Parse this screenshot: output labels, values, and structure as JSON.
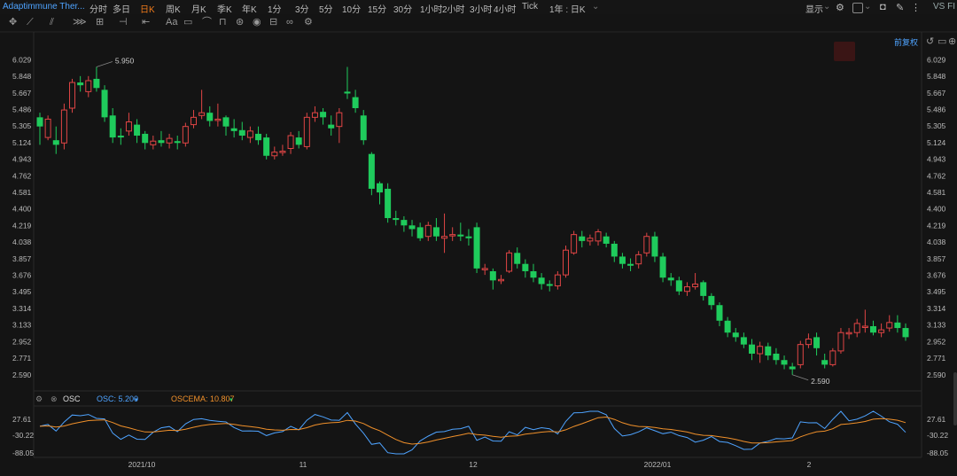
{
  "topbar": {
    "title": "Adaptimmune Ther...",
    "timeframes": [
      "分时",
      "多日",
      "日K",
      "周K",
      "月K",
      "季K",
      "年K",
      "1分",
      "3分",
      "5分",
      "10分",
      "15分",
      "30分",
      "1小时",
      "2小时",
      "3小时",
      "4小时",
      "Tick"
    ],
    "active_timeframe": "日K",
    "period_select": "1年 : 日K",
    "display_label": "显示",
    "compare_label": "VS FI"
  },
  "toolbar": {
    "icons": [
      "move-icon",
      "line-icon",
      "channel-icon",
      "fib-icon",
      "measure-icon",
      "hline-icon",
      "arrow-icon",
      "text-icon",
      "note-icon",
      "brush-icon",
      "magnet-icon",
      "eye-icon",
      "delete-icon",
      "link-icon",
      "settings-icon"
    ]
  },
  "chart_controls": {
    "adjust_label": "前复权"
  },
  "indicator": {
    "name": "OSC",
    "osc_label": "OSC: 5.200",
    "oscema_label": "OSCEMA: 10.807",
    "osc_color": "#4ea3ff",
    "oscema_color": "#f0902a",
    "y_ticks": [
      "27.61",
      "-30.22",
      "-88.05"
    ]
  },
  "chart_data": {
    "type": "candlestick",
    "up_color": "#e04545",
    "down_color": "#1fcb5c",
    "y_ticks": [
      "6.029",
      "5.848",
      "5.667",
      "5.486",
      "5.305",
      "5.124",
      "4.943",
      "4.762",
      "4.581",
      "4.400",
      "4.219",
      "4.038",
      "3.857",
      "3.676",
      "3.495",
      "3.314",
      "3.133",
      "2.952",
      "2.771",
      "2.590"
    ],
    "ylim": [
      2.52,
      6.1
    ],
    "x_ticks": [
      "2021/10",
      "11",
      "12",
      "2022/01",
      "2"
    ],
    "high_annotation": "5.950",
    "low_annotation": "2.590",
    "candles": [
      [
        5.4,
        5.3,
        5.45,
        5.1
      ],
      [
        5.18,
        5.38,
        5.42,
        5.15
      ],
      [
        5.15,
        5.1,
        5.3,
        5.0
      ],
      [
        5.12,
        5.48,
        5.55,
        5.05
      ],
      [
        5.5,
        5.78,
        5.82,
        5.45
      ],
      [
        5.78,
        5.75,
        5.85,
        5.68
      ],
      [
        5.68,
        5.8,
        5.85,
        5.62
      ],
      [
        5.82,
        5.72,
        5.95,
        5.68
      ],
      [
        5.7,
        5.4,
        5.75,
        5.35
      ],
      [
        5.42,
        5.18,
        5.5,
        5.12
      ],
      [
        5.2,
        5.18,
        5.28,
        5.1
      ],
      [
        5.25,
        5.35,
        5.45,
        5.2
      ],
      [
        5.32,
        5.2,
        5.38,
        5.12
      ],
      [
        5.22,
        5.12,
        5.25,
        5.05
      ],
      [
        5.1,
        5.14,
        5.2,
        5.05
      ],
      [
        5.15,
        5.12,
        5.25,
        5.08
      ],
      [
        5.12,
        5.17,
        5.22,
        5.06
      ],
      [
        5.14,
        5.12,
        5.2,
        5.05
      ],
      [
        5.12,
        5.3,
        5.34,
        5.08
      ],
      [
        5.32,
        5.4,
        5.48,
        5.28
      ],
      [
        5.42,
        5.45,
        5.7,
        5.38
      ],
      [
        5.45,
        5.36,
        5.52,
        5.3
      ],
      [
        5.38,
        5.38,
        5.55,
        5.3
      ],
      [
        5.4,
        5.3,
        5.42,
        5.2
      ],
      [
        5.28,
        5.25,
        5.38,
        5.18
      ],
      [
        5.26,
        5.2,
        5.35,
        5.15
      ],
      [
        5.18,
        5.25,
        5.3,
        5.12
      ],
      [
        5.22,
        5.15,
        5.3,
        5.1
      ],
      [
        5.18,
        4.98,
        5.22,
        4.94
      ],
      [
        4.98,
        5.02,
        5.08,
        4.94
      ],
      [
        5.02,
        5.03,
        5.1,
        4.98
      ],
      [
        5.06,
        5.2,
        5.24,
        5.0
      ],
      [
        5.18,
        5.1,
        5.25,
        5.06
      ],
      [
        5.08,
        5.4,
        5.45,
        5.05
      ],
      [
        5.4,
        5.45,
        5.52,
        5.35
      ],
      [
        5.46,
        5.4,
        5.5,
        5.32
      ],
      [
        5.32,
        5.28,
        5.42,
        5.2
      ],
      [
        5.3,
        5.45,
        5.5,
        5.12
      ],
      [
        5.68,
        5.66,
        5.95,
        5.6
      ],
      [
        5.62,
        5.5,
        5.7,
        5.45
      ],
      [
        5.42,
        5.15,
        5.48,
        5.1
      ],
      [
        5.0,
        4.62,
        5.02,
        4.55
      ],
      [
        4.68,
        4.58,
        4.7,
        4.45
      ],
      [
        4.62,
        4.3,
        4.68,
        4.25
      ],
      [
        4.3,
        4.28,
        4.38,
        4.22
      ],
      [
        4.28,
        4.22,
        4.32,
        4.15
      ],
      [
        4.22,
        4.18,
        4.28,
        4.1
      ],
      [
        4.2,
        4.08,
        4.25,
        4.05
      ],
      [
        4.1,
        4.22,
        4.26,
        4.05
      ],
      [
        4.2,
        4.1,
        4.3,
        4.05
      ],
      [
        4.08,
        4.1,
        4.35,
        3.92
      ],
      [
        4.12,
        4.12,
        4.2,
        4.05
      ],
      [
        4.12,
        4.1,
        4.25,
        4.05
      ],
      [
        4.1,
        4.08,
        4.18,
        4.0
      ],
      [
        4.2,
        3.75,
        4.25,
        3.7
      ],
      [
        3.75,
        3.75,
        3.8,
        3.68
      ],
      [
        3.72,
        3.62,
        3.75,
        3.52
      ],
      [
        3.62,
        3.63,
        3.68,
        3.58
      ],
      [
        3.72,
        3.92,
        3.95,
        3.7
      ],
      [
        3.92,
        3.8,
        3.98,
        3.75
      ],
      [
        3.8,
        3.72,
        3.85,
        3.65
      ],
      [
        3.72,
        3.65,
        3.8,
        3.6
      ],
      [
        3.65,
        3.58,
        3.7,
        3.52
      ],
      [
        3.58,
        3.56,
        3.62,
        3.5
      ],
      [
        3.56,
        3.68,
        3.72,
        3.52
      ],
      [
        3.68,
        3.95,
        4.0,
        3.65
      ],
      [
        3.92,
        4.12,
        4.16,
        3.9
      ],
      [
        4.1,
        4.05,
        4.16,
        3.98
      ],
      [
        4.05,
        4.08,
        4.12,
        4.0
      ],
      [
        4.05,
        4.15,
        4.18,
        4.0
      ],
      [
        4.1,
        4.02,
        4.14,
        3.98
      ],
      [
        4.02,
        3.88,
        4.05,
        3.82
      ],
      [
        3.88,
        3.8,
        3.92,
        3.75
      ],
      [
        3.8,
        3.78,
        3.86,
        3.72
      ],
      [
        3.8,
        3.9,
        3.94,
        3.75
      ],
      [
        3.92,
        4.1,
        4.14,
        3.88
      ],
      [
        4.1,
        3.88,
        4.15,
        3.82
      ],
      [
        3.88,
        3.65,
        3.92,
        3.6
      ],
      [
        3.65,
        3.62,
        3.7,
        3.56
      ],
      [
        3.62,
        3.5,
        3.66,
        3.46
      ],
      [
        3.5,
        3.55,
        3.6,
        3.45
      ],
      [
        3.55,
        3.58,
        3.7,
        3.52
      ],
      [
        3.6,
        3.45,
        3.62,
        3.4
      ],
      [
        3.45,
        3.35,
        3.48,
        3.3
      ],
      [
        3.35,
        3.18,
        3.38,
        3.12
      ],
      [
        3.18,
        3.05,
        3.22,
        3.0
      ],
      [
        3.05,
        3.0,
        3.1,
        2.95
      ],
      [
        3.0,
        2.92,
        3.05,
        2.88
      ],
      [
        2.92,
        2.82,
        2.98,
        2.75
      ],
      [
        2.82,
        2.9,
        2.95,
        2.72
      ],
      [
        2.9,
        2.8,
        2.94,
        2.75
      ],
      [
        2.82,
        2.75,
        2.88,
        2.7
      ],
      [
        2.75,
        2.7,
        2.8,
        2.65
      ],
      [
        2.68,
        2.65,
        2.72,
        2.59
      ],
      [
        2.7,
        2.92,
        2.96,
        2.66
      ],
      [
        2.92,
        2.98,
        3.04,
        2.88
      ],
      [
        3.0,
        2.88,
        3.05,
        2.8
      ],
      [
        2.75,
        2.7,
        2.82,
        2.66
      ],
      [
        2.7,
        2.85,
        2.88,
        2.68
      ],
      [
        2.85,
        3.05,
        3.1,
        2.82
      ],
      [
        3.05,
        3.05,
        3.1,
        2.98
      ],
      [
        3.05,
        3.15,
        3.2,
        3.0
      ],
      [
        3.12,
        3.12,
        3.3,
        3.05
      ],
      [
        3.12,
        3.05,
        3.18,
        3.02
      ],
      [
        3.05,
        3.08,
        3.15,
        3.0
      ],
      [
        3.1,
        3.16,
        3.24,
        3.06
      ],
      [
        3.16,
        3.1,
        3.24,
        3.05
      ],
      [
        3.1,
        3.0,
        3.15,
        2.96
      ]
    ]
  }
}
